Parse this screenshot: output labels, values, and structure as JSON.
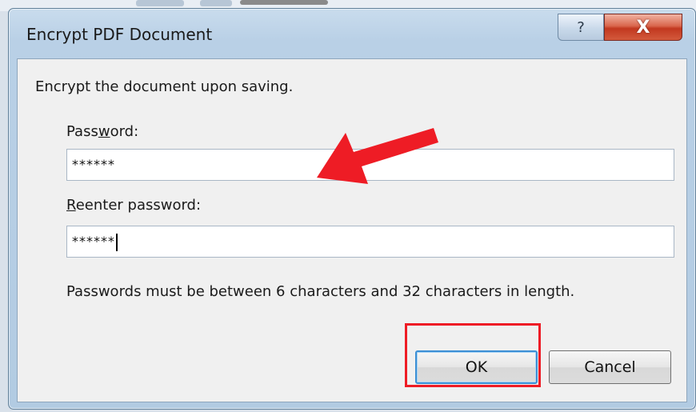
{
  "dialog": {
    "title": "Encrypt PDF Document",
    "help_glyph": "?",
    "close_glyph": "X",
    "intro": "Encrypt the document upon saving.",
    "password": {
      "label_before": "Pass",
      "label_underlined": "w",
      "label_after": "ord:",
      "value": "******"
    },
    "reenter": {
      "label_underlined": "R",
      "label_after": "eenter password:",
      "value": "******"
    },
    "note": "Passwords must be between 6 characters and 32 characters in length.",
    "ok_label": "OK",
    "cancel_label": "Cancel"
  },
  "annotations": {
    "arrow_color": "#ee1c25",
    "highlight_color": "#ee1c25"
  }
}
